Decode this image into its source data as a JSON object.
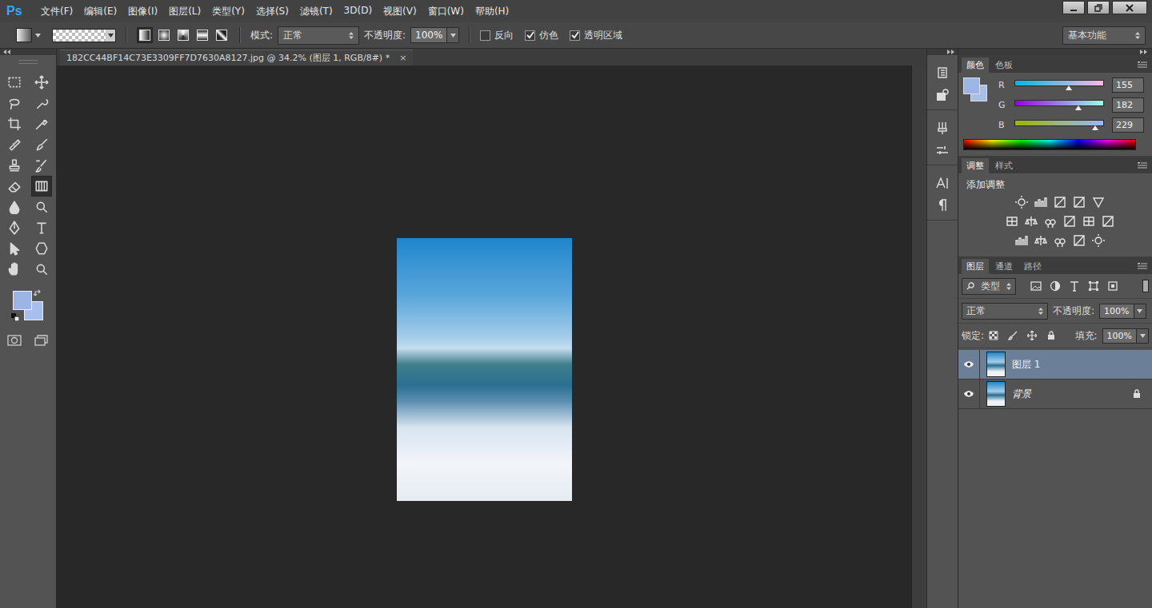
{
  "app": {
    "logo": "Ps"
  },
  "menu": [
    "文件(F)",
    "编辑(E)",
    "图像(I)",
    "图层(L)",
    "类型(Y)",
    "选择(S)",
    "滤镜(T)",
    "3D(D)",
    "视图(V)",
    "窗口(W)",
    "帮助(H)"
  ],
  "options_bar": {
    "gradient_types": [
      {
        "selected": true
      },
      {
        "selected": false
      },
      {
        "selected": false
      },
      {
        "selected": false
      },
      {
        "selected": false
      }
    ],
    "mode_label": "模式:",
    "mode_value": "正常",
    "opacity_label": "不透明度:",
    "opacity_value": "100%",
    "checkboxes": [
      {
        "label": "反向",
        "checked": false
      },
      {
        "label": "仿色",
        "checked": true
      },
      {
        "label": "透明区域",
        "checked": true
      }
    ],
    "workspace": "基本功能"
  },
  "document_tab": {
    "title": "182CC44BF14C73E3309FF7D7630A8127.jpg @ 34.2% (图层 1, RGB/8#) *",
    "close": "×"
  },
  "tools": [
    {
      "selected": false
    },
    {
      "selected": false
    },
    {
      "selected": false
    },
    {
      "selected": false
    },
    {
      "selected": false
    },
    {
      "selected": false
    },
    {
      "selected": false
    },
    {
      "selected": false
    },
    {
      "selected": false
    },
    {
      "selected": false
    },
    {
      "selected": false
    },
    {
      "selected": true
    },
    {
      "selected": false
    },
    {
      "selected": false
    },
    {
      "selected": false
    },
    {
      "selected": false
    },
    {
      "selected": false
    },
    {
      "selected": false
    },
    {
      "selected": false
    },
    {
      "selected": false
    }
  ],
  "color_panel": {
    "tabs": [
      {
        "label": "颜色",
        "selected": true
      },
      {
        "label": "色板",
        "selected": false
      }
    ],
    "channels": [
      {
        "name": "R",
        "value": "155",
        "level": 0.608
      },
      {
        "name": "G",
        "value": "182",
        "level": 0.714
      },
      {
        "name": "B",
        "value": "229",
        "level": 0.898
      }
    ]
  },
  "adjustments_panel": {
    "tabs": [
      {
        "label": "调整",
        "selected": true
      },
      {
        "label": "样式",
        "selected": false
      }
    ],
    "heading": "添加调整"
  },
  "layers_panel": {
    "tabs": [
      {
        "label": "图层",
        "selected": true
      },
      {
        "label": "通道",
        "selected": false
      },
      {
        "label": "路径",
        "selected": false
      }
    ],
    "filter": "类型",
    "blend_mode": "正常",
    "opacity_label": "不透明度:",
    "opacity_value": "100%",
    "lock_label": "锁定:",
    "fill_label": "填充:",
    "fill_value": "100%",
    "layers": [
      {
        "name": "图层 1",
        "visible": true,
        "selected": true,
        "locked": false,
        "italic": false
      },
      {
        "name": "背景",
        "visible": true,
        "selected": false,
        "locked": true,
        "italic": true
      }
    ]
  }
}
